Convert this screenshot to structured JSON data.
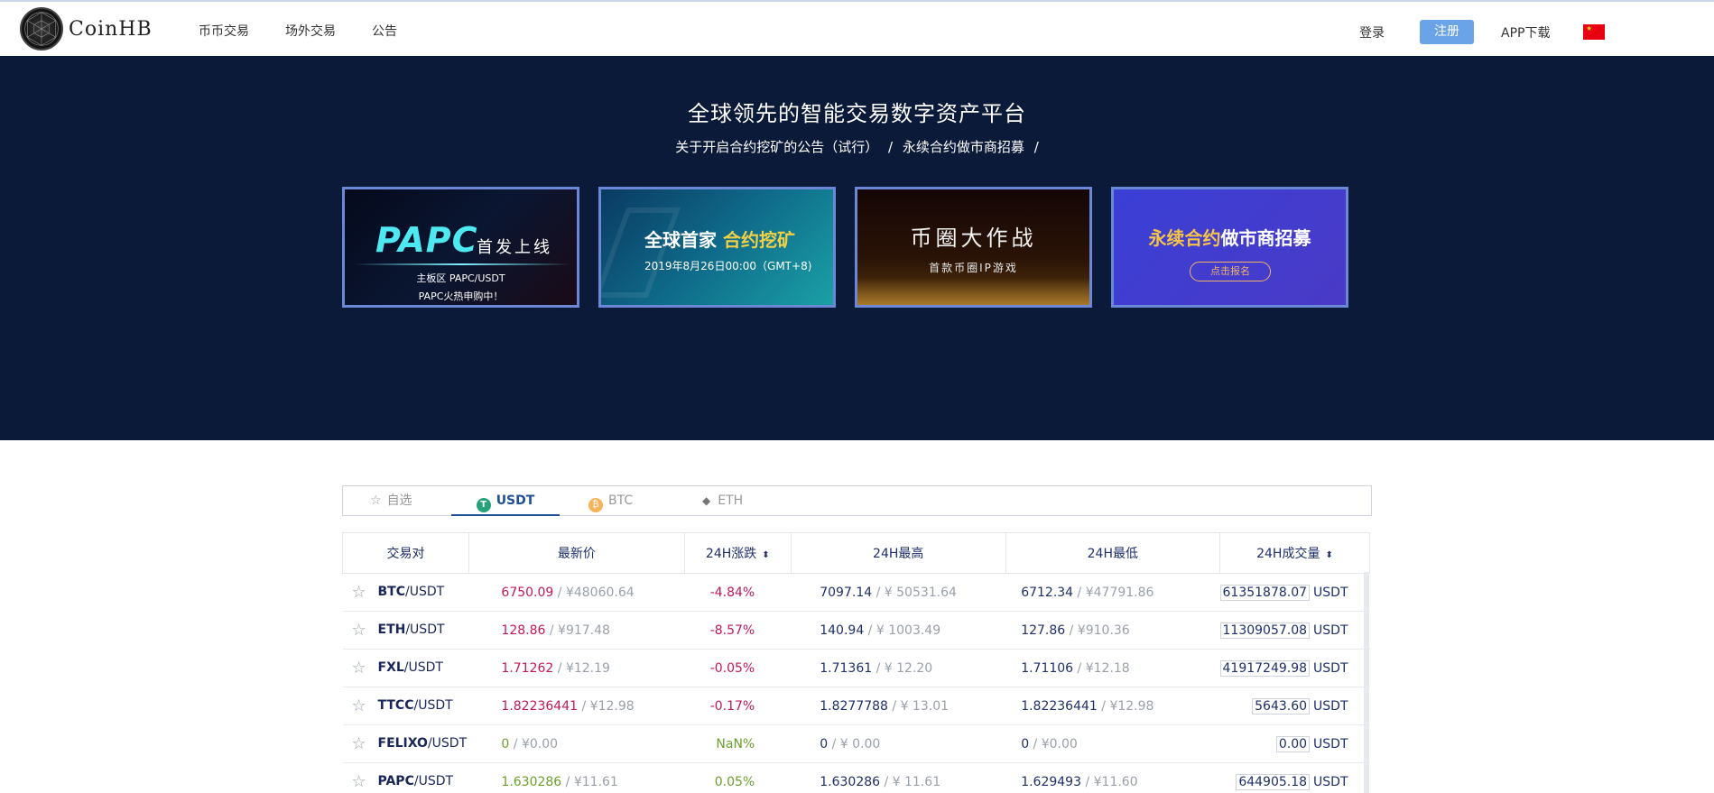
{
  "header": {
    "brand": "CoinHB",
    "nav": [
      "币币交易",
      "场外交易",
      "公告"
    ],
    "login": "登录",
    "register": "注册",
    "app_download": "APP下载"
  },
  "banner": {
    "title": "全球领先的智能交易数字资产平台",
    "links": [
      "关于开启合约挖矿的公告（试行）",
      "/",
      "永续合约做市商招募",
      "/"
    ],
    "cards": [
      {
        "t1": "PAPC",
        "t2": "首发上线",
        "s1": "主板区 PAPC/USDT",
        "s2": "PAPC火热申购中！"
      },
      {
        "t1": "全球首家",
        "t2": "合约挖矿",
        "s1": "2019年8月26日00:00（GMT+8)"
      },
      {
        "t1": "币圈大作战",
        "s1": "首款币圈IP游戏"
      },
      {
        "t1": "永续合约",
        "t2": "做市商招募",
        "btn": "点击报名"
      }
    ]
  },
  "tabs": {
    "fav": "自选",
    "usdt": "USDT",
    "btc": "BTC",
    "eth": "ETH"
  },
  "table": {
    "headers": [
      "交易对",
      "最新价",
      "24H涨跌",
      "24H最高",
      "24H最低",
      "24H成交量"
    ],
    "rows": [
      {
        "base": "BTC",
        "quote": "/USDT",
        "price": "6750.09",
        "price_cny": "¥48060.64",
        "chg": "-4.84%",
        "high": "7097.14",
        "high_cny": "¥ 50531.64",
        "low": "6712.34",
        "low_cny": "¥47791.86",
        "vol": "61351878.07",
        "unit": "USDT",
        "dir": "red"
      },
      {
        "base": "ETH",
        "quote": "/USDT",
        "price": "128.86",
        "price_cny": "¥917.48",
        "chg": "-8.57%",
        "high": "140.94",
        "high_cny": "¥ 1003.49",
        "low": "127.86",
        "low_cny": "¥910.36",
        "vol": "11309057.08",
        "unit": "USDT",
        "dir": "red"
      },
      {
        "base": "FXL",
        "quote": "/USDT",
        "price": "1.71262",
        "price_cny": "¥12.19",
        "chg": "-0.05%",
        "high": "1.71361",
        "high_cny": "¥ 12.20",
        "low": "1.71106",
        "low_cny": "¥12.18",
        "vol": "41917249.98",
        "unit": "USDT",
        "dir": "red"
      },
      {
        "base": "TTCC",
        "quote": "/USDT",
        "price": "1.82236441",
        "price_cny": "¥12.98",
        "chg": "-0.17%",
        "high": "1.8277788",
        "high_cny": "¥ 13.01",
        "low": "1.82236441",
        "low_cny": "¥12.98",
        "vol": "5643.60",
        "unit": "USDT",
        "dir": "red"
      },
      {
        "base": "FELIXO",
        "quote": "/USDT",
        "price": "0",
        "price_cny": "¥0.00",
        "chg": "NaN%",
        "high": "0",
        "high_cny": "¥ 0.00",
        "low": "0",
        "low_cny": "¥0.00",
        "vol": "0.00",
        "unit": "USDT",
        "dir": "green"
      },
      {
        "base": "PAPC",
        "quote": "/USDT",
        "price": "1.630286",
        "price_cny": "¥11.61",
        "chg": "0.05%",
        "high": "1.630286",
        "high_cny": "¥ 11.61",
        "low": "1.629493",
        "low_cny": "¥11.60",
        "vol": "644905.18",
        "unit": "USDT",
        "dir": "green"
      }
    ]
  },
  "colors": {
    "banner_bg": "#0c1a3a",
    "accent": "#1f4f97",
    "down": "#c2185b",
    "up": "#6aa02c",
    "register_btn": "#6aa3e8"
  }
}
